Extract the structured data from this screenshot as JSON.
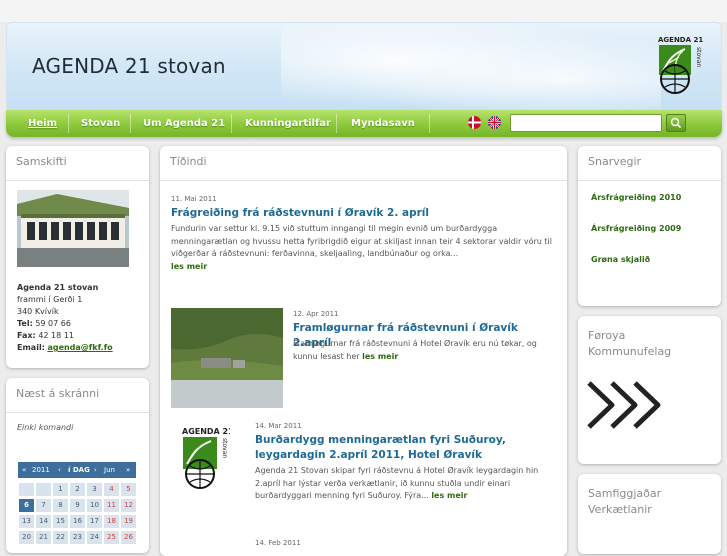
{
  "header": {
    "title": "AGENDA 21 stovan",
    "logo_text": "AGENDA 21",
    "logo_side_text": "stovan"
  },
  "nav": {
    "items": [
      {
        "label": "Heim",
        "active": true
      },
      {
        "label": "Stovan",
        "active": false
      },
      {
        "label": "Um Agenda 21",
        "active": false
      },
      {
        "label": "Kunningartilfar",
        "active": false
      },
      {
        "label": "Myndasavn",
        "active": false
      }
    ],
    "search_value": "",
    "colors": {
      "nav_green": "#8cc83a",
      "link_blue": "#1e6a96",
      "link_green": "#2e6a10",
      "calendar_blue": "#3d6e9c"
    }
  },
  "samskifti": {
    "title": "Samskifti",
    "name": "Agenda 21 stovan",
    "address1": "frammi í Gerði 1",
    "address2": "340 Kvívík",
    "tel_label": "Tel:",
    "tel": "59 07 66",
    "fax_label": "Fax:",
    "fax": "42 18 11",
    "email_label": "Email:",
    "email": "agenda@fkf.fo"
  },
  "naest": {
    "title": "Næst á skránni",
    "empty_text": "Einki komandi",
    "calendar": {
      "prev_year": "«",
      "year": "2011",
      "prev_month": "‹",
      "today_label": "í DAG",
      "next_month": "›",
      "month": "Jun",
      "next_year": "»",
      "rows": [
        [
          "",
          "",
          "1",
          "2",
          "3",
          "4",
          "5"
        ],
        [
          "6",
          "7",
          "8",
          "9",
          "10",
          "11",
          "12"
        ],
        [
          "13",
          "14",
          "15",
          "16",
          "17",
          "18",
          "19"
        ],
        [
          "20",
          "21",
          "22",
          "23",
          "24",
          "25",
          "26"
        ]
      ],
      "today": "6"
    }
  },
  "news": {
    "title": "Tíðindi",
    "items": [
      {
        "date": "11. Mai 2011",
        "title": "Frágreiðing frá ráðstevnuni í Øravík 2. apríl",
        "body": "Fundurin var settur kl. 9.15 við stuttum inngangi til megin evnið um burðardygga menningarætlan og hvussu hetta fyribrigdið eigur at skiljast innan teir 4 sektorar valdir vóru til viðgerðar á ráðstevnuni: ferðavinna, skeljaaling, landbúnaður og orka...",
        "more": "les meir"
      },
      {
        "date": "12. Apr 2011",
        "title": "Framløgurnar frá ráðstevnuni í Øravík 2.apríl",
        "body": "Framløgurnar frá ráðstevnuni á Hotel Øravík eru nú tøkar, og kunnu lesast her",
        "more": "les meir"
      },
      {
        "date": "14. Mar 2011",
        "title": "Burðardygg menningarætlan fyri Suðuroy, leygardagin 2.apríl 2011, Hotel Øravík",
        "body": "Agenda 21 Stovan skipar fyri ráðstevnu á Hotel Øravík leygardagin hin 2.apríl har lýstar verða verkætlanir, ið kunnu stuðla undir einari burðardyggari menning fyri Suðuroy. Fýra...",
        "more": "les meir"
      },
      {
        "date": "14. Feb 2011"
      }
    ]
  },
  "snarvegir": {
    "title": "Snarvegir",
    "links": [
      "Ársfrágreiðing 2010",
      "Ársfrágreiðing 2009",
      "Grøna skjalið"
    ]
  },
  "foroya": {
    "title_line1": "Føroya",
    "title_line2": "Kommunufelag"
  },
  "samfiggjadar": {
    "title_line1": "Samfiggjaðar",
    "title_line2": "Verkætlanir"
  }
}
